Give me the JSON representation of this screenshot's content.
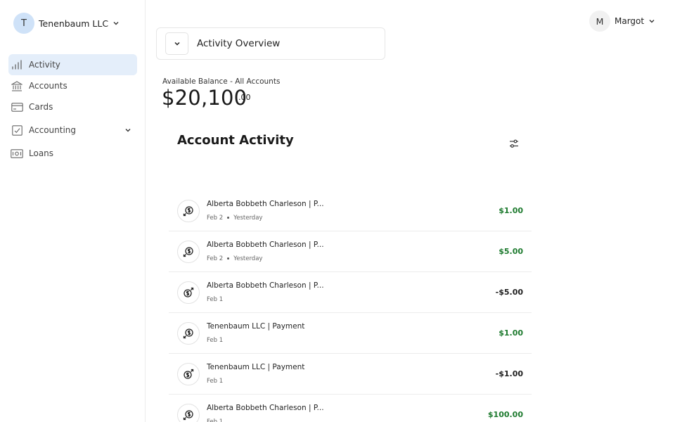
{
  "org": {
    "initial": "T",
    "name": "Tenenbaum LLC"
  },
  "user": {
    "initial": "M",
    "name": "Margot"
  },
  "nav": [
    {
      "label": "Activity",
      "icon": "bar-chart-icon",
      "active": true
    },
    {
      "label": "Accounts",
      "icon": "bank-icon"
    },
    {
      "label": "Cards",
      "icon": "credit-card-icon"
    },
    {
      "label": "Accounting",
      "icon": "ledger-icon",
      "expandable": true
    },
    {
      "label": "Loans",
      "icon": "cash-icon"
    }
  ],
  "overview": {
    "title": "Activity Overview"
  },
  "balance": {
    "label": "Available Balance - All Accounts",
    "amount": "$20,100",
    "cents": ".00"
  },
  "activity": {
    "title": "Account Activity",
    "rows": [
      {
        "name": "Alberta Bobbeth Charleson | P...",
        "date": "Feb 2",
        "relative": "Yesterday",
        "amount": "$1.00",
        "direction": "in"
      },
      {
        "name": "Alberta Bobbeth Charleson | P...",
        "date": "Feb 2",
        "relative": "Yesterday",
        "amount": "$5.00",
        "direction": "in"
      },
      {
        "name": "Alberta Bobbeth Charleson | P...",
        "date": "Feb 1",
        "relative": "",
        "amount": "-$5.00",
        "direction": "out"
      },
      {
        "name": "Tenenbaum LLC | Payment",
        "date": "Feb 1",
        "relative": "",
        "amount": "$1.00",
        "direction": "in"
      },
      {
        "name": "Tenenbaum LLC | Payment",
        "date": "Feb 1",
        "relative": "",
        "amount": "-$1.00",
        "direction": "out"
      },
      {
        "name": "Alberta Bobbeth Charleson | P...",
        "date": "Feb 1",
        "relative": "",
        "amount": "$100.00",
        "direction": "in"
      }
    ]
  },
  "colors": {
    "active_bg": "#e4eefa",
    "org_avatar": "#cfe2f8",
    "positive": "#1d7a2e"
  }
}
